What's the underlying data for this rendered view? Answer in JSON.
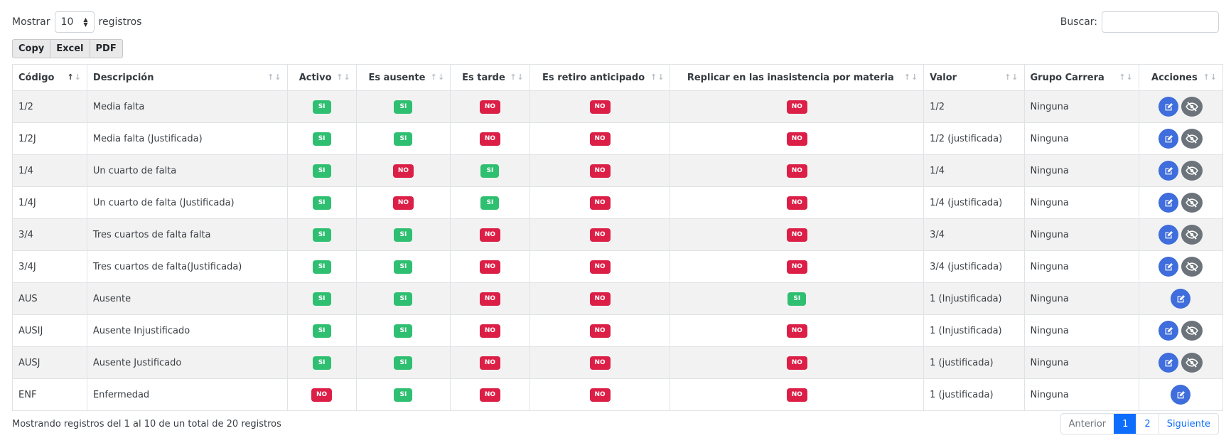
{
  "length": {
    "label_before": "Mostrar",
    "value": "10",
    "label_after": "registros"
  },
  "search": {
    "label": "Buscar:",
    "value": ""
  },
  "export_buttons": [
    "Copy",
    "Excel",
    "PDF"
  ],
  "columns": [
    {
      "key": "codigo",
      "label": "Código",
      "align": "left",
      "sorted": "asc"
    },
    {
      "key": "descripcion",
      "label": "Descripción",
      "align": "left"
    },
    {
      "key": "activo",
      "label": "Activo",
      "align": "center"
    },
    {
      "key": "ausente",
      "label": "Es ausente",
      "align": "center"
    },
    {
      "key": "tarde",
      "label": "Es tarde",
      "align": "center"
    },
    {
      "key": "retiro",
      "label": "Es retiro anticipado",
      "align": "center"
    },
    {
      "key": "replicar",
      "label": "Replicar en las inasistencia por materia",
      "align": "center"
    },
    {
      "key": "valor",
      "label": "Valor",
      "align": "left"
    },
    {
      "key": "grupo",
      "label": "Grupo Carrera",
      "align": "left"
    },
    {
      "key": "acciones",
      "label": "Acciones",
      "align": "center"
    }
  ],
  "badge_labels": {
    "yes": "SI",
    "no": "NO"
  },
  "rows": [
    {
      "codigo": "1/2",
      "descripcion": "Media falta",
      "activo": true,
      "ausente": true,
      "tarde": false,
      "retiro": false,
      "replicar": false,
      "valor": "1/2",
      "grupo": "Ninguna",
      "actions": [
        "edit",
        "hide"
      ]
    },
    {
      "codigo": "1/2J",
      "descripcion": "Media falta (Justificada)",
      "activo": true,
      "ausente": true,
      "tarde": false,
      "retiro": false,
      "replicar": false,
      "valor": "1/2 (justificada)",
      "grupo": "Ninguna",
      "actions": [
        "edit",
        "hide"
      ]
    },
    {
      "codigo": "1/4",
      "descripcion": "Un cuarto de falta",
      "activo": true,
      "ausente": false,
      "tarde": true,
      "retiro": false,
      "replicar": false,
      "valor": "1/4",
      "grupo": "Ninguna",
      "actions": [
        "edit",
        "hide"
      ]
    },
    {
      "codigo": "1/4J",
      "descripcion": "Un cuarto de falta (Justificada)",
      "activo": true,
      "ausente": false,
      "tarde": true,
      "retiro": false,
      "replicar": false,
      "valor": "1/4 (justificada)",
      "grupo": "Ninguna",
      "actions": [
        "edit",
        "hide"
      ]
    },
    {
      "codigo": "3/4",
      "descripcion": "Tres cuartos de falta falta",
      "activo": true,
      "ausente": true,
      "tarde": false,
      "retiro": false,
      "replicar": false,
      "valor": "3/4",
      "grupo": "Ninguna",
      "actions": [
        "edit",
        "hide"
      ]
    },
    {
      "codigo": "3/4J",
      "descripcion": "Tres cuartos de falta(Justificada)",
      "activo": true,
      "ausente": true,
      "tarde": false,
      "retiro": false,
      "replicar": false,
      "valor": "3/4 (justificada)",
      "grupo": "Ninguna",
      "actions": [
        "edit",
        "hide"
      ]
    },
    {
      "codigo": "AUS",
      "descripcion": "Ausente",
      "activo": true,
      "ausente": true,
      "tarde": false,
      "retiro": false,
      "replicar": true,
      "valor": "1 (Injustificada)",
      "grupo": "Ninguna",
      "actions": [
        "edit"
      ]
    },
    {
      "codigo": "AUSIJ",
      "descripcion": "Ausente Injustificado",
      "activo": true,
      "ausente": true,
      "tarde": false,
      "retiro": false,
      "replicar": false,
      "valor": "1 (Injustificada)",
      "grupo": "Ninguna",
      "actions": [
        "edit",
        "hide"
      ]
    },
    {
      "codigo": "AUSJ",
      "descripcion": "Ausente Justificado",
      "activo": true,
      "ausente": true,
      "tarde": false,
      "retiro": false,
      "replicar": false,
      "valor": "1 (justificada)",
      "grupo": "Ninguna",
      "actions": [
        "edit",
        "hide"
      ]
    },
    {
      "codigo": "ENF",
      "descripcion": "Enfermedad",
      "activo": false,
      "ausente": true,
      "tarde": false,
      "retiro": false,
      "replicar": false,
      "valor": "1 (justificada)",
      "grupo": "Ninguna",
      "actions": [
        "edit"
      ]
    }
  ],
  "footer": {
    "info": "Mostrando registros del 1 al 10 de un total de 20 registros"
  },
  "pagination": {
    "previous": "Anterior",
    "pages": [
      "1",
      "2"
    ],
    "current": "1",
    "next": "Siguiente"
  },
  "colors": {
    "yes": "#2fbf71",
    "no": "#dc1f47",
    "edit": "#3f6ddb",
    "hide": "#6c737a",
    "primary": "#0d6efd"
  },
  "icons": {
    "edit": "edit-icon",
    "hide": "eye-off-icon"
  }
}
